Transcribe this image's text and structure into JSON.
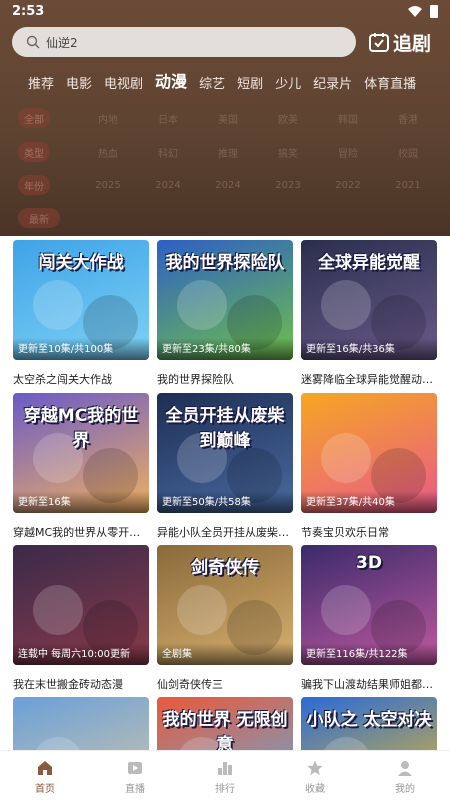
{
  "status_bar": {
    "time": "2:53"
  },
  "search": {
    "query": "仙逆2",
    "follow_label": "追剧"
  },
  "categories": [
    {
      "label": "推荐"
    },
    {
      "label": "电影"
    },
    {
      "label": "电视剧"
    },
    {
      "label": "动漫"
    },
    {
      "label": "综艺"
    },
    {
      "label": "短剧"
    },
    {
      "label": "少儿"
    },
    {
      "label": "纪录片"
    },
    {
      "label": "体育直播"
    }
  ],
  "filters": [
    {
      "key": "全部",
      "options": [
        "内地",
        "日本",
        "美国",
        "欧美",
        "韩国",
        "香港"
      ]
    },
    {
      "key": "类型",
      "options": [
        "热血",
        "科幻",
        "推理",
        "搞笑",
        "冒险",
        "校园"
      ]
    },
    {
      "key": "年份",
      "options": [
        "2025",
        "2024",
        "2024",
        "2023",
        "2022",
        "2021"
      ]
    },
    {
      "key": "最新",
      "options": [
        "",
        "",
        ""
      ]
    }
  ],
  "cards": [
    {
      "poster_text": "闯关大作战",
      "badge": "更新至10集/共100集",
      "title": "太空杀之闯关大作战",
      "color1": "#3fa3e8",
      "color2": "#7ed1f4"
    },
    {
      "poster_text": "我的世界探险队",
      "badge": "更新至23集/共80集",
      "title": "我的世界探险队",
      "color1": "#2d5fc6",
      "color2": "#6fc04a"
    },
    {
      "poster_text": "全球异能觉醒",
      "badge": "更新至16集/共36集",
      "title": "迷雾降临全球异能觉醒动…",
      "color1": "#2a2f4d",
      "color2": "#6a5a8a"
    },
    {
      "poster_text": "穿越MC我的世界",
      "badge": "更新至16集",
      "title": "穿越MC我的世界从零开始…",
      "color1": "#6a5ac8",
      "color2": "#f0b060"
    },
    {
      "poster_text": "全员开挂从废柴到巅峰",
      "badge": "更新至50集/共58集",
      "title": "异能小队全员开挂从废柴…",
      "color1": "#1d2e55",
      "color2": "#4a6aa0"
    },
    {
      "poster_text": "",
      "badge": "更新至37集/共40集",
      "title": "节奏宝贝欢乐日常",
      "color1": "#f6a623",
      "color2": "#e85a8a"
    },
    {
      "poster_text": "",
      "badge": "连载中 每周六10:00更新",
      "title": "我在末世搬金砖动态漫",
      "color1": "#3a2a4a",
      "color2": "#8a3a4a"
    },
    {
      "poster_text": "剑奇侠传",
      "badge": "全剧集",
      "title": "仙剑奇侠传三",
      "color1": "#8a6a3a",
      "color2": "#d8b070"
    },
    {
      "poster_text": "3D",
      "badge": "更新至116集/共122集",
      "title": "骗我下山渡劫结果师姐都…",
      "color1": "#3a2a6a",
      "color2": "#c05aa0"
    },
    {
      "poster_text": "",
      "badge": "",
      "title": "",
      "color1": "#6aa0d8",
      "color2": "#d8c8a8"
    },
    {
      "poster_text": "我的世界 无限创意",
      "badge": "",
      "title": "",
      "color1": "#e85a3a",
      "color2": "#5ab0e8"
    },
    {
      "poster_text": "小队之 太空对决",
      "badge": "",
      "title": "",
      "color1": "#2a6ad8",
      "color2": "#f0c020"
    }
  ],
  "bottom_nav": [
    {
      "label": "首页",
      "icon": "home-icon"
    },
    {
      "label": "直播",
      "icon": "live-icon"
    },
    {
      "label": "排行",
      "icon": "rank-icon"
    },
    {
      "label": "收藏",
      "icon": "star-icon"
    },
    {
      "label": "我的",
      "icon": "user-icon"
    }
  ],
  "colors": {
    "header": "#5e4331",
    "accent": "#8a5a3c"
  }
}
